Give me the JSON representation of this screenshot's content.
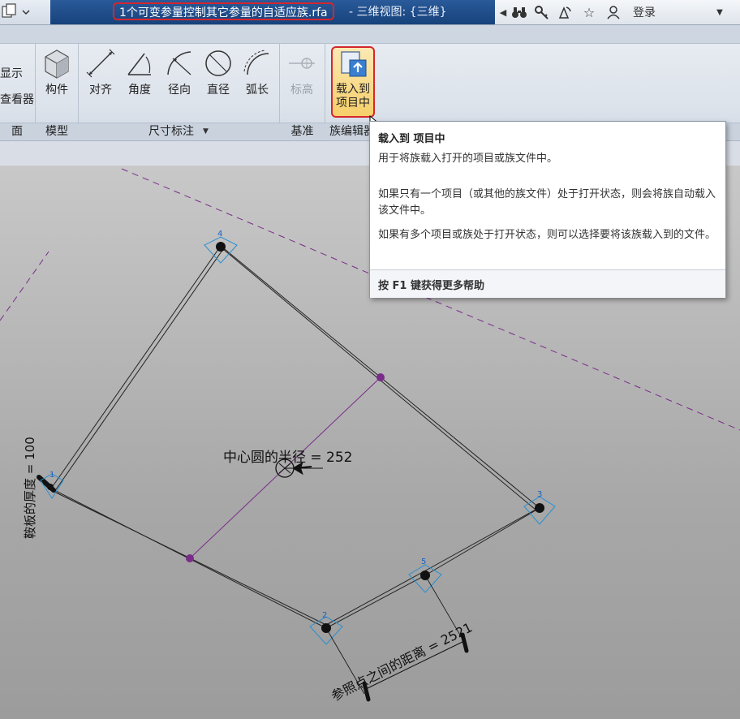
{
  "titlebar": {
    "doc_title": "1个可变参量控制其它参量的自适应族.rfa",
    "view_title": "- 三维视图: {三维}",
    "login_label": "登录"
  },
  "ribbon": {
    "partial_labels": {
      "show": "显示",
      "viewer": "查看器"
    },
    "buttons": {
      "component": "构件",
      "aligned": "对齐",
      "angular": "角度",
      "radial": "径向",
      "diameter": "直径",
      "arc_length": "弧长",
      "level": "标高",
      "load_into_project_line1": "载入到",
      "load_into_project_line2": "项目中"
    },
    "panels": {
      "partial": "面",
      "model": "模型",
      "dimension": "尺寸标注",
      "datum": "基准",
      "family_editor": "族编辑器"
    }
  },
  "tooltip": {
    "title": "载入到 项目中",
    "p1": "用于将族载入打开的项目或族文件中。",
    "p2": "如果只有一个项目（或其他的族文件）处于打开状态，则会将族自动载入该文件中。",
    "p3": "如果有多个项目或族处于打开状态，则可以选择要将该族载入到的文件。",
    "help": "按 F1 键获得更多帮助"
  },
  "canvas": {
    "points": [
      "1",
      "2",
      "3",
      "4",
      "5"
    ],
    "label_radius": "中心圆的半径 = 252",
    "label_thickness": "鞍板的厚度 = 100",
    "label_distance": "参照点之间的距离 = 2521"
  },
  "colors": {
    "highlight_red": "#d6262e",
    "title_band": "#1f4c89",
    "reference_purple": "#7a2c8a",
    "point_blue": "#2a8fd0"
  }
}
